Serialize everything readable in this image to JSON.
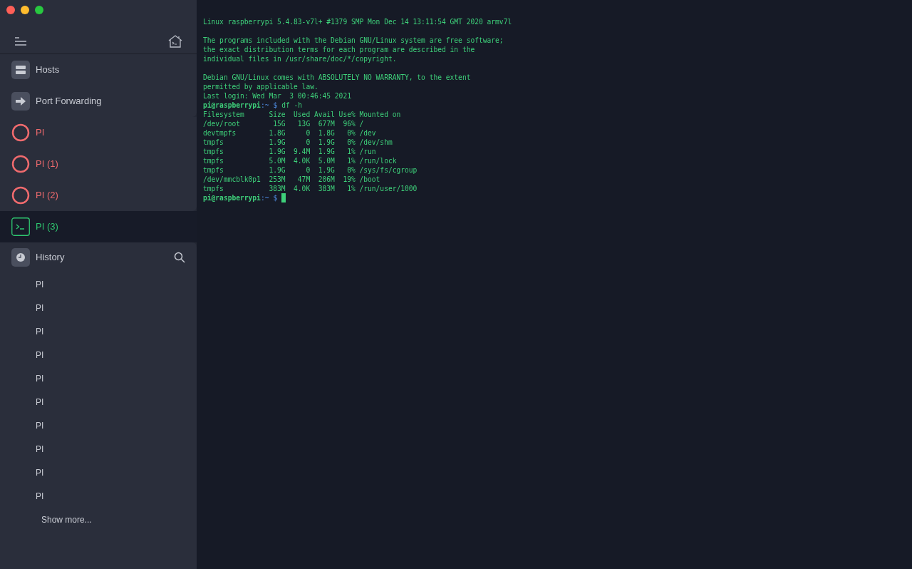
{
  "sidebar": {
    "nav": [
      {
        "kind": "hosts",
        "label": "Hosts"
      },
      {
        "kind": "forwarding",
        "label": "Port Forwarding"
      }
    ],
    "sessions": [
      {
        "label": "PI",
        "connected": false,
        "selected": false
      },
      {
        "label": "PI (1)",
        "connected": false,
        "selected": false
      },
      {
        "label": "PI (2)",
        "connected": false,
        "selected": false
      },
      {
        "label": "PI (3)",
        "connected": true,
        "selected": true
      }
    ],
    "history": {
      "label": "History",
      "items": [
        "PI",
        "PI",
        "PI",
        "PI",
        "PI",
        "PI",
        "PI",
        "PI",
        "PI",
        "PI"
      ],
      "show_more": "Show more..."
    }
  },
  "terminal": {
    "blocks": [
      [
        {
          "kind": "output",
          "text": "Linux raspberrypi 5.4.83-v7l+ #1379 SMP Mon Dec 14 13:11:54 GMT 2020 armv7l"
        }
      ],
      [
        {
          "kind": "output",
          "text": "The programs included with the Debian GNU/Linux system are free software;"
        },
        {
          "kind": "output",
          "text": "the exact distribution terms for each program are described in the"
        },
        {
          "kind": "output",
          "text": "individual files in /usr/share/doc/*/copyright."
        }
      ],
      [
        {
          "kind": "output",
          "text": "Debian GNU/Linux comes with ABSOLUTELY NO WARRANTY, to the extent"
        },
        {
          "kind": "output",
          "text": "permitted by applicable law."
        },
        {
          "kind": "output",
          "text": "Last login: Wed Mar  3 00:46:45 2021"
        },
        {
          "kind": "prompt",
          "user_host": "pi@raspberrypi",
          "path": ":~",
          "symbol": "$",
          "command": "df -h",
          "cursor": false
        },
        {
          "kind": "output",
          "text": "Filesystem      Size  Used Avail Use% Mounted on"
        },
        {
          "kind": "output",
          "text": "/dev/root        15G   13G  677M  96% /"
        },
        {
          "kind": "output",
          "text": "devtmpfs        1.8G     0  1.8G   0% /dev"
        },
        {
          "kind": "output",
          "text": "tmpfs           1.9G     0  1.9G   0% /dev/shm"
        },
        {
          "kind": "output",
          "text": "tmpfs           1.9G  9.4M  1.9G   1% /run"
        },
        {
          "kind": "output",
          "text": "tmpfs           5.0M  4.0K  5.0M   1% /run/lock"
        },
        {
          "kind": "output",
          "text": "tmpfs           1.9G     0  1.9G   0% /sys/fs/cgroup"
        },
        {
          "kind": "output",
          "text": "/dev/mmcblk0p1  253M   47M  206M  19% /boot"
        },
        {
          "kind": "output",
          "text": "tmpfs           383M  4.0K  383M   1% /run/user/1000"
        },
        {
          "kind": "prompt",
          "user_host": "pi@raspberrypi",
          "path": ":~",
          "symbol": "$",
          "cursor": true
        }
      ]
    ]
  }
}
